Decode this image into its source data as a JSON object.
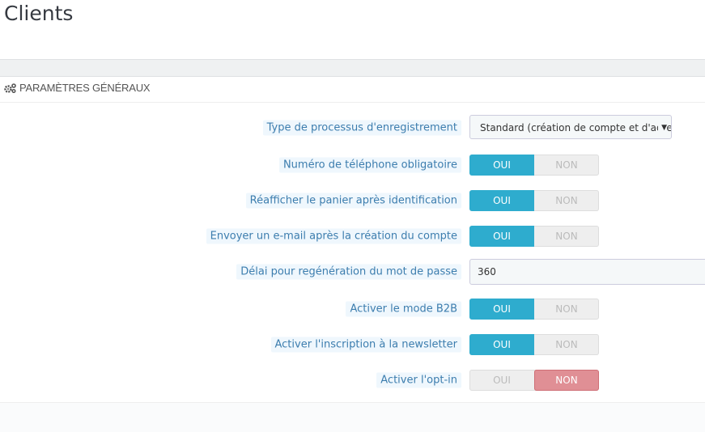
{
  "page": {
    "title": "Clients"
  },
  "panel": {
    "heading": "PARAMÈTRES GÉNÉRAUX",
    "icon": "cogs-icon"
  },
  "select_row": {
    "label": "Type de processus d'enregistrement",
    "value": "Standard (création de compte et d'adresse)",
    "arrow": "▼"
  },
  "input_row": {
    "label": "Délai pour regénération du mot de passe",
    "value": "360"
  },
  "switch_yes": "OUI",
  "switch_no": "NON",
  "switches": [
    {
      "label": "Numéro de téléphone obligatoire",
      "value": "yes"
    },
    {
      "label": "Réafficher le panier après identification",
      "value": "yes"
    },
    {
      "label": "Envoyer un e-mail après la création du compte",
      "value": "yes"
    },
    {
      "label": "Activer le mode B2B",
      "value": "yes"
    },
    {
      "label": "Activer l'inscription à la newsletter",
      "value": "yes"
    },
    {
      "label": "Activer l'opt-in",
      "value": "no"
    }
  ],
  "colors": {
    "yes_active": "#2eacce",
    "no_active": "#e08f95",
    "label_text": "#3c7dae"
  }
}
